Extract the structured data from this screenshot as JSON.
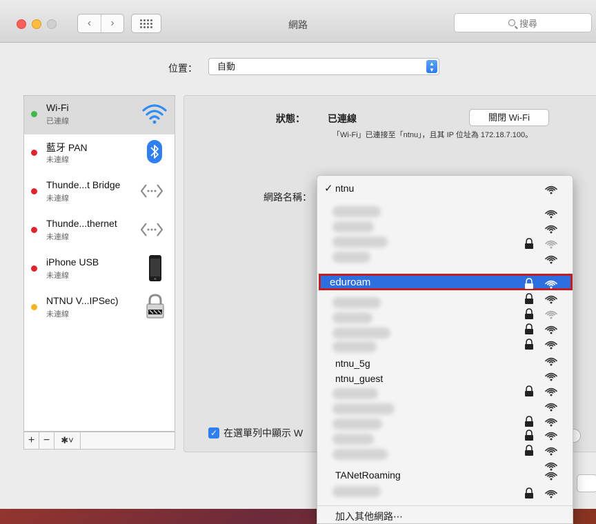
{
  "window": {
    "title": "網路"
  },
  "toolbar": {
    "search_placeholder": "搜尋"
  },
  "location": {
    "label": "位置：",
    "value": "自動"
  },
  "services": [
    {
      "name": "Wi-Fi",
      "status": "已連線",
      "dot": "#3cb94a",
      "icon": "wifi-icon"
    },
    {
      "name": "藍牙 PAN",
      "status": "未連線",
      "dot": "#e0242f",
      "icon": "bluetooth-icon"
    },
    {
      "name": "Thunde...t Bridge",
      "status": "未連線",
      "dot": "#e0242f",
      "icon": "ethernet-arrows-icon"
    },
    {
      "name": "Thunde...thernet",
      "status": "未連線",
      "dot": "#e0242f",
      "icon": "ethernet-arrows-icon"
    },
    {
      "name": "iPhone USB",
      "status": "未連線",
      "dot": "#e0242f",
      "icon": "iphone-icon"
    },
    {
      "name": "NTNU V...IPSec)",
      "status": "未連線",
      "dot": "#f5b223",
      "icon": "vpn-lock-icon"
    }
  ],
  "sidebar_tools": {
    "add": "+",
    "remove": "−"
  },
  "detail": {
    "status_label": "狀態：",
    "status_value": "已連線",
    "wifi_off_button": "關閉 Wi-Fi",
    "status_desc": "「Wi-Fi」已連接至「ntnu」，且其 IP 位址為 172.18.7.100。",
    "network_name_label": "網路名稱：",
    "show_in_menubar": "在選單列中顯示 W"
  },
  "networks": {
    "current": "ntnu",
    "highlighted": "eduroam",
    "named": [
      "ntnu_5g",
      "ntnu_guest",
      "TANetRoaming"
    ],
    "join_other": "加入其他網路⋯"
  },
  "colors": {
    "accent": "#2e6fe0",
    "highlight_border": "#c01d24"
  }
}
